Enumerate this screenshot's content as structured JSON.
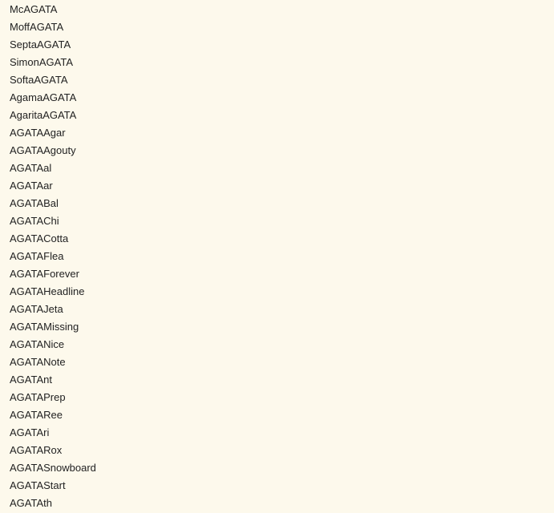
{
  "colors": {
    "background": "#fdf9ec",
    "text": "#222222"
  },
  "names": [
    "McAGATA",
    "MoffAGATA",
    "SeptaAGATA",
    "SimonAGATA",
    "SoftaAGATA",
    "AgamaAGATA",
    "AgaritaAGATA",
    "AGATAAgar",
    "AGATAAgouty",
    "AGATAal",
    "AGATAar",
    "AGATABal",
    "AGATAChi",
    "AGATACotta",
    "AGATAFlea",
    "AGATAForever",
    "AGATAHeadline",
    "AGATAJeta",
    "AGATAMissing",
    "AGATANice",
    "AGATANote",
    "AGATAnt",
    "AGATAPrep",
    "AGATARee",
    "AGATAri",
    "AGATARox",
    "AGATASnowboard",
    "AGATAStart",
    "AGATAth"
  ]
}
